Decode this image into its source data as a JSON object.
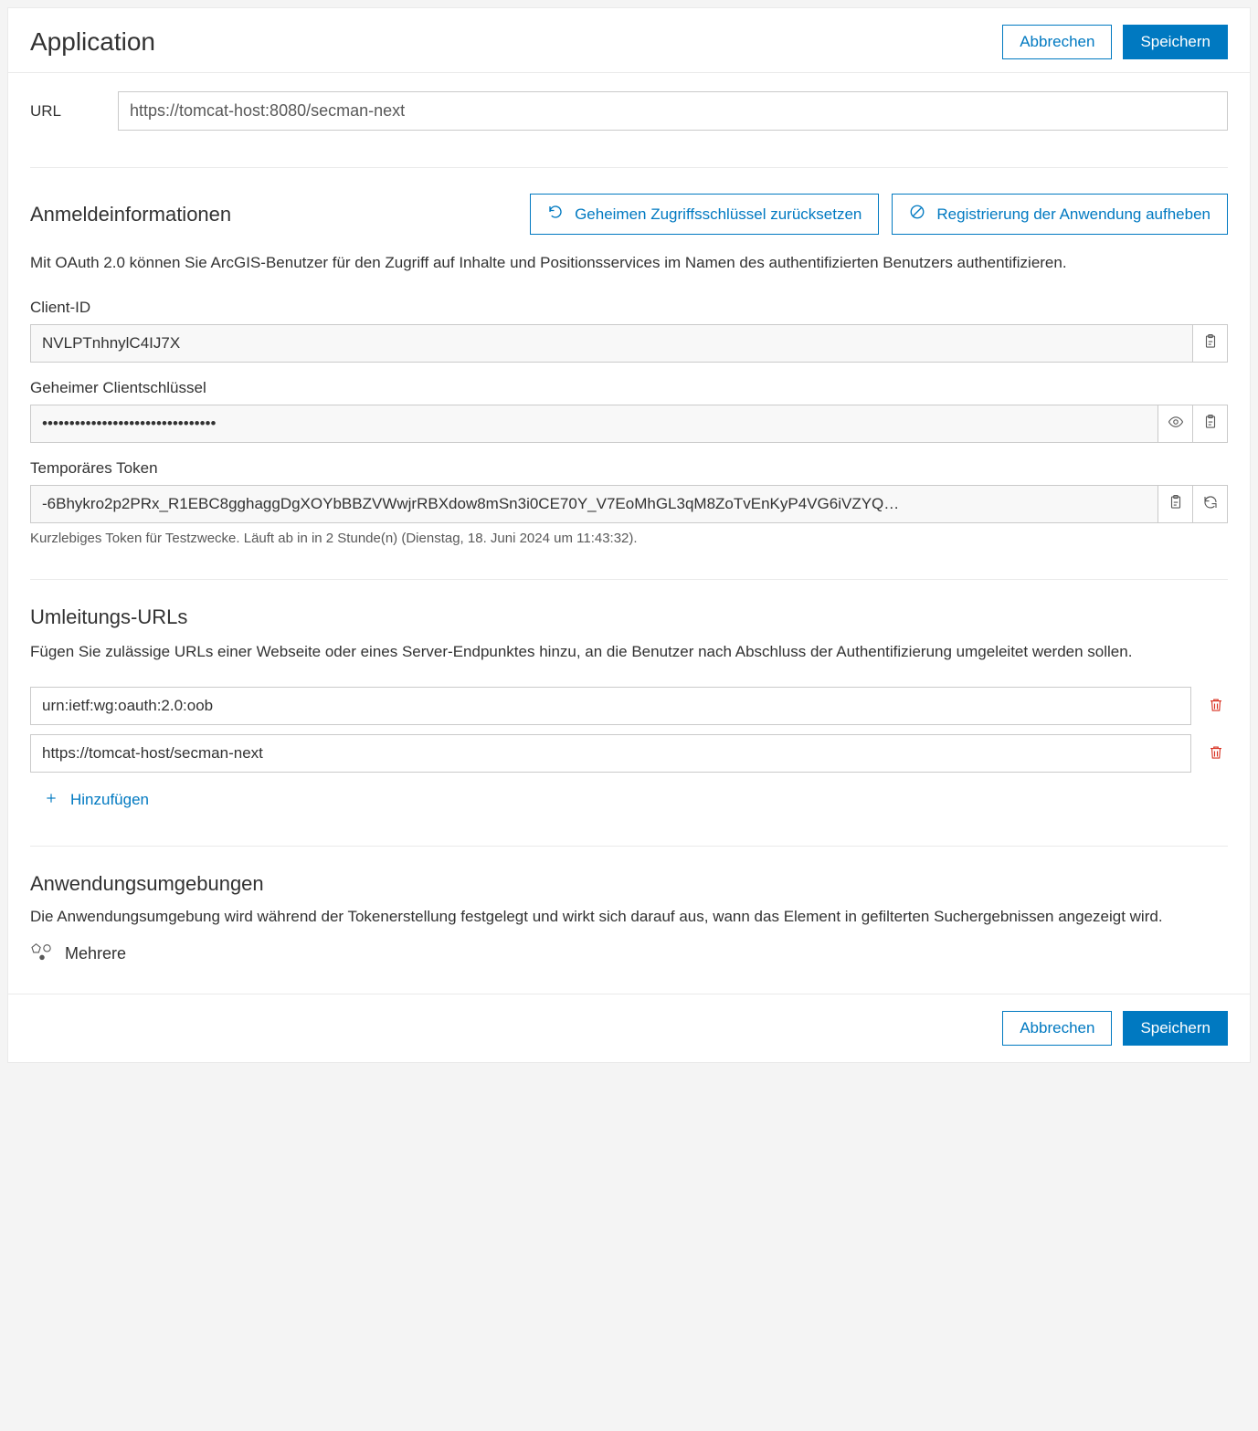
{
  "header": {
    "title": "Application",
    "cancel": "Abbrechen",
    "save": "Speichern"
  },
  "url": {
    "label": "URL",
    "value": "https://tomcat-host:8080/secman-next"
  },
  "credentials": {
    "title": "Anmeldeinformationen",
    "reset_secret": "Geheimen Zugriffsschlüssel zurücksetzen",
    "unregister": "Registrierung der Anwendung aufheben",
    "desc": "Mit OAuth 2.0 können Sie ArcGIS-Benutzer für den Zugriff auf Inhalte und Positionsservices im Namen des authentifizierten Benutzers authentifizieren.",
    "client_id": {
      "label": "Client-ID",
      "value": "NVLPTnhnylC4IJ7X"
    },
    "client_secret": {
      "label": "Geheimer Clientschlüssel",
      "value": "••••••••••••••••••••••••••••••••"
    },
    "temp_token": {
      "label": "Temporäres Token",
      "value": "-6Bhykro2p2PRx_R1EBC8gghaggDgXOYbBBZVWwjrRBXdow8mSn3i0CE70Y_V7EoMhGL3qM8ZoTvEnKyP4VG6iVZYQ…",
      "hint": "Kurzlebiges Token für Testzwecke. Läuft ab in in 2 Stunde(n) (Dienstag, 18. Juni 2024 um 11:43:32)."
    }
  },
  "redirects": {
    "title": "Umleitungs-URLs",
    "desc": "Fügen Sie zulässige URLs einer Webseite oder eines Server-Endpunktes hinzu, an die Benutzer nach Abschluss der Authentifizierung umgeleitet werden sollen.",
    "urls": [
      "urn:ietf:wg:oauth:2.0:oob",
      "https://tomcat-host/secman-next"
    ],
    "add": "Hinzufügen"
  },
  "environments": {
    "title": "Anwendungsumgebungen",
    "desc": "Die Anwendungsumgebung wird während der Tokenerstellung festgelegt und wirkt sich darauf aus, wann das Element in gefilterten Suchergebnissen angezeigt wird.",
    "value": "Mehrere"
  },
  "footer": {
    "cancel": "Abbrechen",
    "save": "Speichern"
  }
}
